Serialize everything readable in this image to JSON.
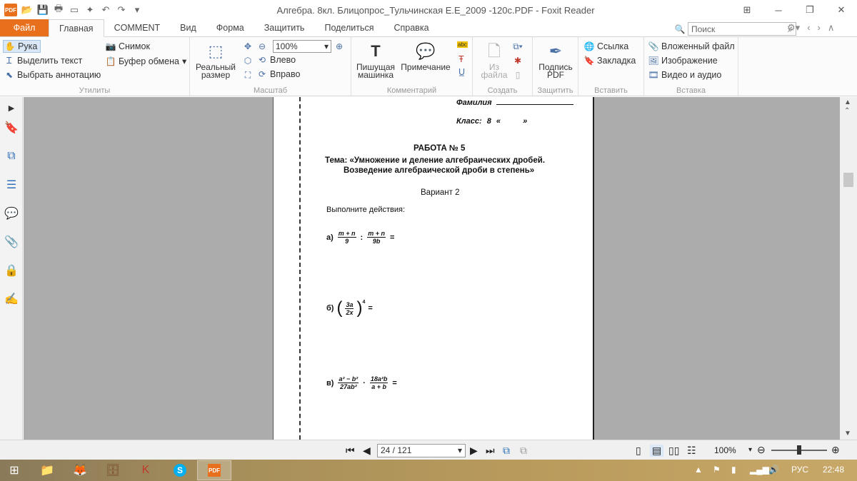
{
  "window": {
    "title": "Алгебра. 8кл. Блицопрос_Тульчинская Е.Е_2009 -120с.PDF - Foxit Reader",
    "logo_text": "PDF"
  },
  "tabs": [
    {
      "label": "Файл"
    },
    {
      "label": "Главная"
    },
    {
      "label": "COMMENT"
    },
    {
      "label": "Вид"
    },
    {
      "label": "Форма"
    },
    {
      "label": "Защитить"
    },
    {
      "label": "Поделиться"
    },
    {
      "label": "Справка"
    }
  ],
  "search": {
    "placeholder": "Поиск"
  },
  "ribbon": {
    "utilities": {
      "label": "Утилиты",
      "hand": "Рука",
      "select_text": "Выделить текст",
      "select_annotation": "Выбрать аннотацию",
      "snapshot": "Снимок",
      "clipboard": "Буфер обмена"
    },
    "zoom": {
      "label": "Масштаб",
      "actual_size_1": "Реальный",
      "actual_size_2": "размер",
      "value": "100%",
      "rotate_left": "Влево",
      "rotate_right": "Вправо"
    },
    "comment": {
      "label": "Комментарий",
      "typewriter_1": "Пишущая",
      "typewriter_2": "машинка",
      "note": "Примечание",
      "abc": "abc"
    },
    "create": {
      "label": "Создать",
      "from_file_1": "Из",
      "from_file_2": "файла"
    },
    "protect": {
      "label": "Защитить",
      "sign_1": "Подпись",
      "sign_2": "PDF"
    },
    "insert": {
      "label": "Вставить",
      "link": "Ссылка",
      "bookmark": "Закладка"
    },
    "insert2": {
      "label": "Вставка",
      "attachment": "Вложенный файл",
      "image": "Изображение",
      "video": "Видео и аудио"
    }
  },
  "document": {
    "surname_label": "Фамилия",
    "class_label": "Класс:",
    "class_value": "8",
    "quote_open": "«",
    "quote_close": "»",
    "work_title": "РАБОТА № 5",
    "topic_line1": "Тема: «Умножение и деление алгебраических дробей.",
    "topic_line2": "Возведение алгебраической дроби в степень»",
    "variant": "Вариант 2",
    "instruction": "Выполните действия:",
    "task_a": {
      "label": "а)",
      "num1": "m + n",
      "den1": "9",
      "op": ":",
      "num2": "m + n",
      "den2": "9b",
      "eq": "="
    },
    "task_b": {
      "label": "б)",
      "num": "3a",
      "den": "2x",
      "exp": "4",
      "eq": "="
    },
    "task_c": {
      "label": "в)",
      "num1": "a² − b²",
      "den1": "27ab²",
      "op": "·",
      "num2": "18a²b",
      "den2": "a + b",
      "eq": "="
    }
  },
  "status": {
    "page": "24 / 121",
    "zoom": "100%"
  },
  "taskbar": {
    "lang": "РУС",
    "time": "22:48"
  }
}
